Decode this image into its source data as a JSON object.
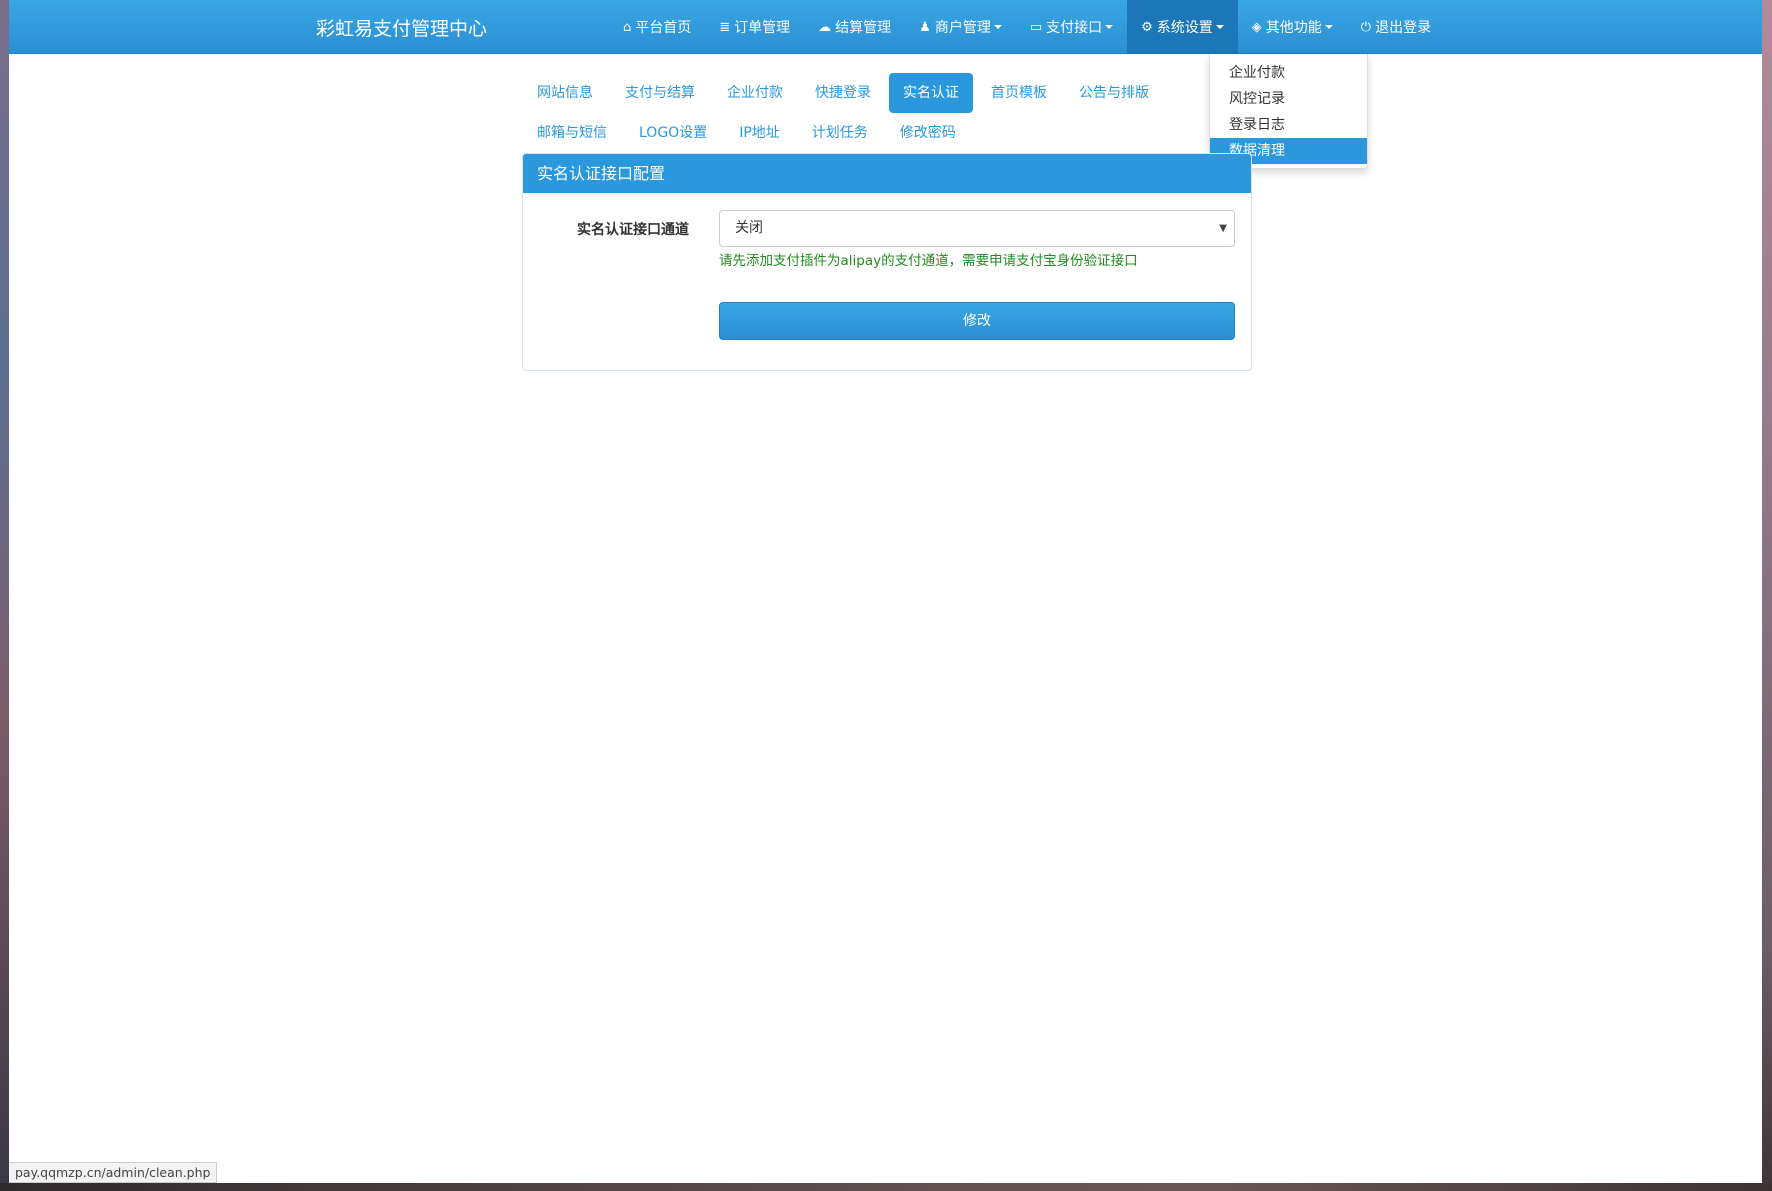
{
  "navbar": {
    "brand": "彩虹易支付管理中心",
    "items": [
      {
        "label": "平台首页",
        "icon": "home-icon",
        "glyph": "⌂"
      },
      {
        "label": "订单管理",
        "icon": "list-icon",
        "glyph": "≣"
      },
      {
        "label": "结算管理",
        "icon": "cloud-icon",
        "glyph": "☁"
      },
      {
        "label": "商户管理",
        "icon": "user-icon",
        "glyph": "♟"
      },
      {
        "label": "支付接口",
        "icon": "credit-card-icon",
        "glyph": "▭"
      },
      {
        "label": "系统设置",
        "icon": "gear-icon",
        "glyph": "⚙"
      },
      {
        "label": "其他功能",
        "icon": "cube-icon",
        "glyph": "◈"
      },
      {
        "label": "退出登录",
        "icon": "power-icon",
        "glyph": "⏻"
      }
    ]
  },
  "dropdown": {
    "items": [
      "企业付款",
      "风控记录",
      "登录日志",
      "数据清理"
    ],
    "active_index": 3
  },
  "tabs": {
    "row1": [
      "网站信息",
      "支付与结算",
      "企业付款",
      "快捷登录",
      "实名认证",
      "首页模板",
      "公告与排版"
    ],
    "row2": [
      "邮箱与短信",
      "LOGO设置",
      "IP地址",
      "计划任务",
      "修改密码"
    ],
    "active": "实名认证"
  },
  "panel": {
    "title": "实名认证接口配置",
    "field_label": "实名认证接口通道",
    "select_value": "关闭",
    "help_text": "请先添加支付插件为alipay的支付通道，需要申请支付宝身份验证接口",
    "submit_label": "修改"
  },
  "statusbar": {
    "url": "pay.qqmzp.cn/admin/clean.php"
  },
  "colors": {
    "primary": "#2b98de",
    "nav_active": "#1c77b8",
    "help_green": "#228b22"
  }
}
